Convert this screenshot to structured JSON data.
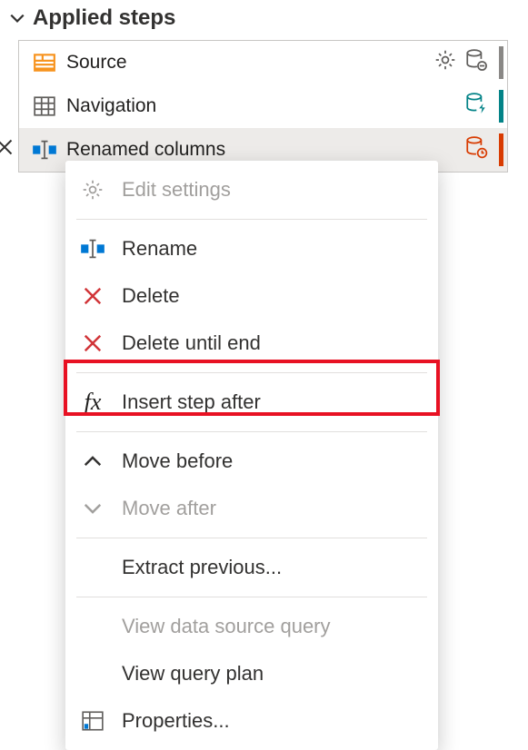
{
  "panel": {
    "title": "Applied steps"
  },
  "steps": {
    "items": [
      {
        "label": "Source"
      },
      {
        "label": "Navigation"
      },
      {
        "label": "Renamed columns"
      }
    ]
  },
  "menu": {
    "edit_settings": "Edit settings",
    "rename": "Rename",
    "delete": "Delete",
    "delete_until_end": "Delete until end",
    "insert_step_after": "Insert step after",
    "move_before": "Move before",
    "move_after": "Move after",
    "extract_previous": "Extract previous...",
    "view_data_source_query": "View data source query",
    "view_query_plan": "View query plan",
    "properties": "Properties..."
  }
}
